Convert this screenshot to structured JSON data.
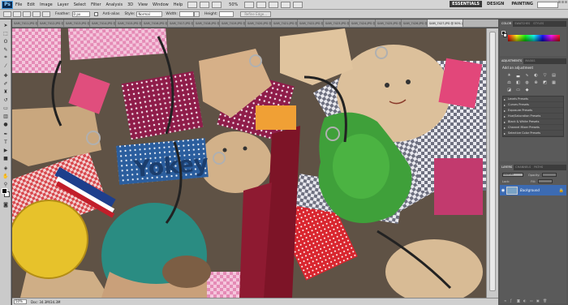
{
  "app": {
    "logo_text": "Ps",
    "menu": [
      "File",
      "Edit",
      "Image",
      "Layer",
      "Select",
      "Filter",
      "Analysis",
      "3D",
      "View",
      "Window",
      "Help"
    ],
    "zoom_level": "50%",
    "workspaces": [
      "ESSENTIALS",
      "DESIGN",
      "PAINTING"
    ]
  },
  "options": {
    "feather_label": "Feather:",
    "feather_value": "0 px",
    "antialias_label": "Anti-alias",
    "style_label": "Style:",
    "style_value": "Normal",
    "width_label": "Width:",
    "height_label": "Height:",
    "refine_label": "Refine Edge..."
  },
  "tabs": [
    {
      "label": "SAM_7411.JPG @ 5..."
    },
    {
      "label": "SAM_7412.JPG @ 5..."
    },
    {
      "label": "SAM_7413.JPG @ 5..."
    },
    {
      "label": "SAM_7414.JPG @ 5..."
    },
    {
      "label": "SAM_7415.JPG @ 5..."
    },
    {
      "label": "SAM_7416.JPG @ 5..."
    },
    {
      "label": "SAM_7417.JPG @ 5..."
    },
    {
      "label": "SAM_7418.JPG @ 5..."
    },
    {
      "label": "SAM_7419.JPG @ 5..."
    },
    {
      "label": "SAM_7420.JPG @ 5..."
    },
    {
      "label": "SAM_7421.JPG @ 5..."
    },
    {
      "label": "SAM_7422.JPG @ 5..."
    },
    {
      "label": "SAM_7423.JPG @ 5..."
    },
    {
      "label": "SAM_7424.JPG @ 5..."
    },
    {
      "label": "SAM_7425.JPG @ 5..."
    },
    {
      "label": "SAM_7426.JPG @ 5..."
    },
    {
      "label": "SAM_7427.JPG @ 50% (RGB/8)",
      "active": true
    }
  ],
  "statusbar": {
    "zoom": "50%",
    "doc_info": "Doc: 34.3M/34.3M"
  },
  "panels": {
    "color_tabs": [
      "COLOR",
      "SWATCHES",
      "STYLES"
    ],
    "adjustment_tabs": [
      "ADJUSTMENTS",
      "MASKS"
    ],
    "adjustment_title": "Add an adjustment",
    "presets": [
      "Levels Presets",
      "Curves Presets",
      "Exposure Presets",
      "Hue/Saturation Presets",
      "Black & White Presets",
      "Channel Mixer Presets",
      "Selective Color Presets"
    ],
    "layer_tabs": [
      "LAYERS",
      "CHANNELS",
      "PATHS"
    ],
    "blend_mode": "Normal",
    "opacity_label": "Opacity:",
    "lock_label": "Lock:",
    "fill_label": "Fill:",
    "layer_name": "Background"
  },
  "colors": {
    "accent": "#3c6bb3",
    "panel_bg": "#5a5a5a",
    "menu_bg": "#d4d4d4"
  },
  "icons": [
    "move-tool-icon",
    "marquee-tool-icon",
    "lasso-tool-icon",
    "quick-select-icon",
    "crop-tool-icon",
    "eyedropper-icon",
    "healing-brush-icon",
    "brush-tool-icon",
    "clone-stamp-icon",
    "history-brush-icon",
    "eraser-icon",
    "gradient-icon",
    "dodge-icon",
    "pen-tool-icon",
    "type-tool-icon",
    "path-select-icon",
    "shape-tool-icon",
    "3d-rotate-icon",
    "hand-tool-icon",
    "zoom-tool-icon",
    "eye-icon",
    "lock-icon"
  ]
}
